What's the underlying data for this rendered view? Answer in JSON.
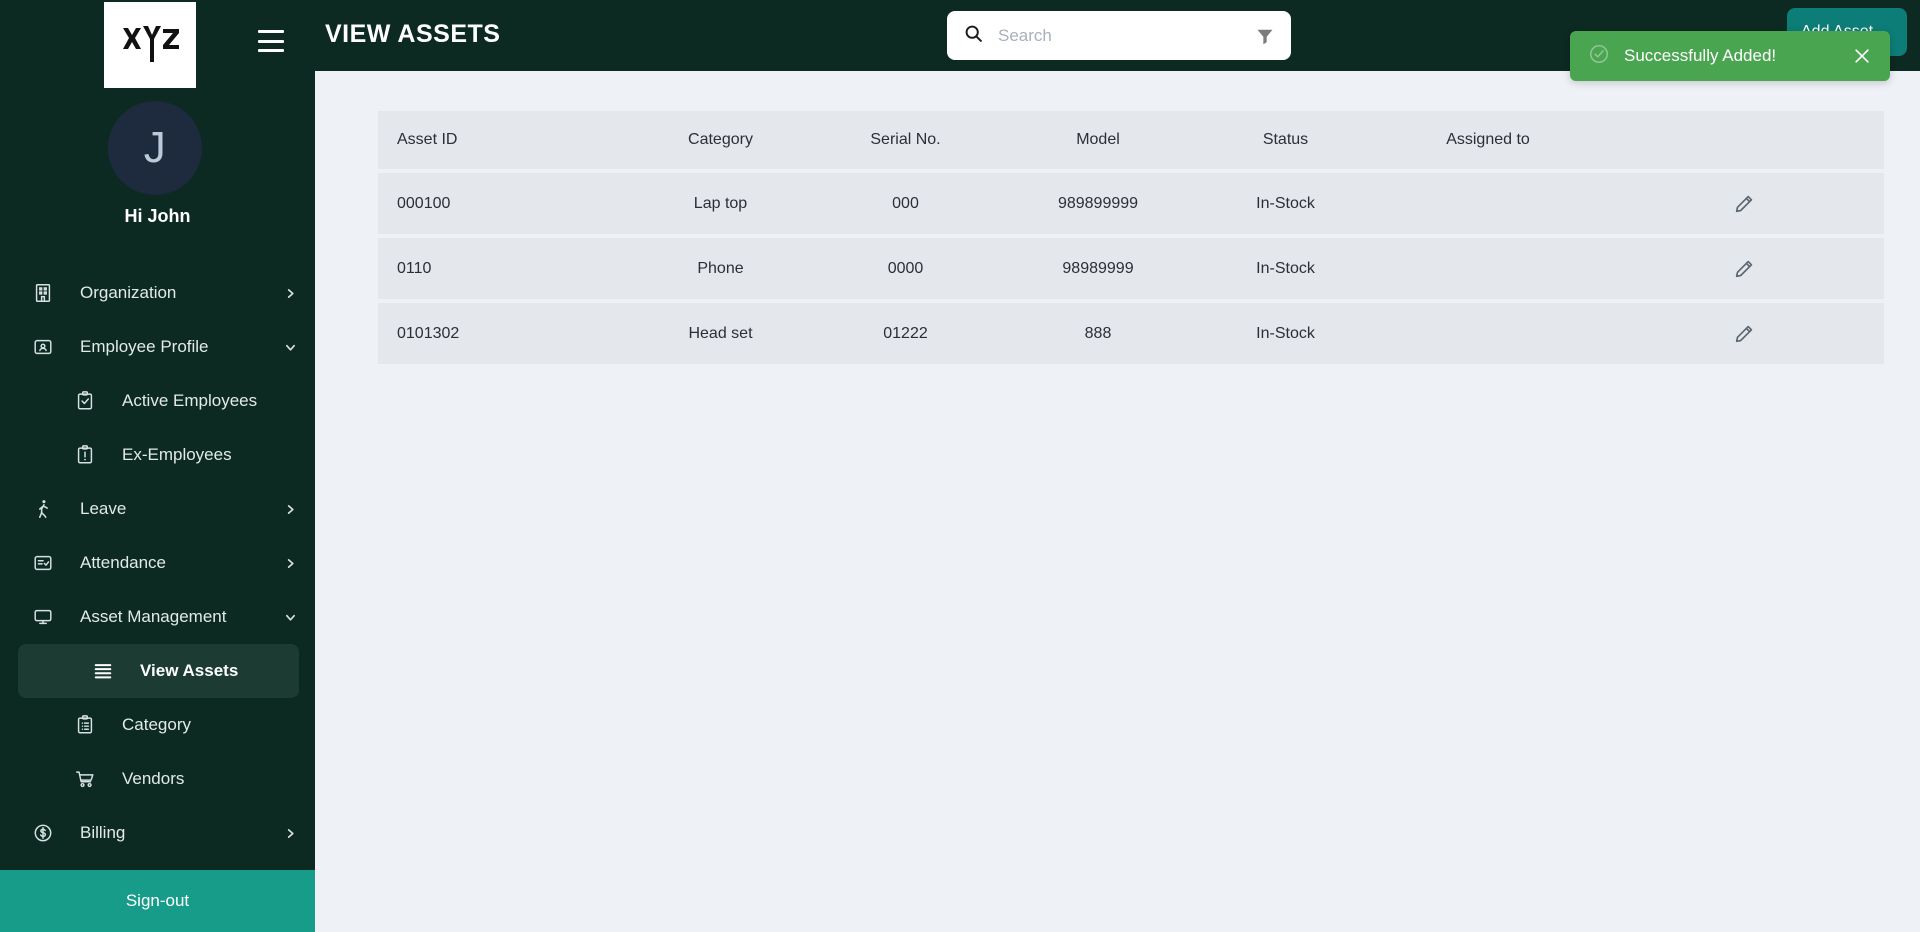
{
  "brand": {
    "logo_text": "XYZ",
    "logo_icon": "xyz-wordmark-logo"
  },
  "sidebar": {
    "menu_toggle_icon": "hamburger-menu-icon",
    "avatar_initial": "J",
    "greeting": "Hi John",
    "items": [
      {
        "label": "Organization",
        "icon": "building-icon",
        "level": 0,
        "chevron": "right",
        "active": false
      },
      {
        "label": "Employee Profile",
        "icon": "id-badge-icon",
        "level": 0,
        "chevron": "down",
        "active": false
      },
      {
        "label": "Active Employees",
        "icon": "clipboard-check-icon",
        "level": 1,
        "chevron": "",
        "active": false
      },
      {
        "label": "Ex-Employees",
        "icon": "clipboard-alert-icon",
        "level": 1,
        "chevron": "",
        "active": false
      },
      {
        "label": "Leave",
        "icon": "walking-person-icon",
        "level": 0,
        "chevron": "right",
        "active": false
      },
      {
        "label": "Attendance",
        "icon": "checklist-icon",
        "level": 0,
        "chevron": "right",
        "active": false
      },
      {
        "label": "Asset Management",
        "icon": "monitor-icon",
        "level": 0,
        "chevron": "down",
        "active": false
      },
      {
        "label": "View Assets",
        "icon": "list-lines-icon",
        "level": 1,
        "chevron": "",
        "active": true
      },
      {
        "label": "Category",
        "icon": "clipboard-list-icon",
        "level": 1,
        "chevron": "",
        "active": false
      },
      {
        "label": "Vendors",
        "icon": "shopping-cart-icon",
        "level": 1,
        "chevron": "",
        "active": false
      },
      {
        "label": "Billing",
        "icon": "dollar-circle-icon",
        "level": 0,
        "chevron": "right",
        "active": false
      }
    ],
    "signout_label": "Sign-out"
  },
  "topbar": {
    "title": "VIEW ASSETS",
    "search": {
      "value": "",
      "placeholder": "Search",
      "icon": "search-icon",
      "filter_icon": "filter-funnel-icon"
    },
    "add_button_label": "Add Asset"
  },
  "table": {
    "columns": [
      "Asset ID",
      "Category",
      "Serial No.",
      "Model",
      "Status",
      "Assigned to",
      ""
    ],
    "rows": [
      {
        "asset_id": "000100",
        "category": "Lap top",
        "serial": "000",
        "model": "989899999",
        "status": "In-Stock",
        "assigned_to": "",
        "action_icon": "edit-pencil-icon"
      },
      {
        "asset_id": "0110",
        "category": "Phone",
        "serial": "0000",
        "model": "98989999",
        "status": "In-Stock",
        "assigned_to": "",
        "action_icon": "edit-pencil-icon"
      },
      {
        "asset_id": "0101302",
        "category": "Head set",
        "serial": "01222",
        "model": "888",
        "status": "In-Stock",
        "assigned_to": "",
        "action_icon": "edit-pencil-icon"
      }
    ]
  },
  "toast": {
    "message": "Successfully Added!",
    "status_icon": "check-circle-icon",
    "close_icon": "close-x-icon",
    "color": "#4aa551"
  },
  "colors": {
    "sidebar_bg": "#0c2a22",
    "sidebar_active": "#1c3b33",
    "signout_teal": "#179c8a",
    "content_bg": "#eef1f6",
    "table_row_bg": "#e4e7ec",
    "toast_green": "#4aa551",
    "add_button_teal": "#0d7d78"
  }
}
